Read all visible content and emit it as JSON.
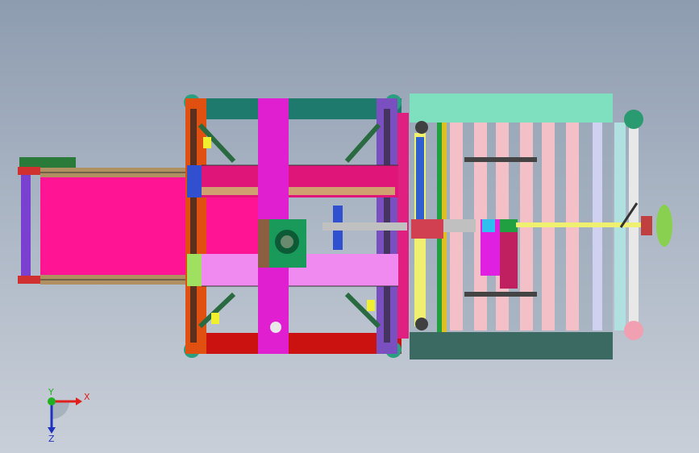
{
  "viewport": {
    "colors": {
      "background_top": "#8e9cb0",
      "background_bottom": "#c9cfd8"
    }
  },
  "triad": {
    "x_label": "X",
    "y_label": "Y",
    "z_label": "Z",
    "colors": {
      "x": "#e0201c",
      "y": "#20b020",
      "z": "#2030c0"
    }
  },
  "model": {
    "colors": {
      "infeed_belt": "#ff1493",
      "main_column": "#e020d0",
      "top_bar": "#1f7a6e",
      "bottom_bar": "#cc1111",
      "left_frame": "#e05010",
      "right_frame": "#7a50c0",
      "upper_carriage": "#e0157a",
      "lower_carriage": "#f08af0",
      "gearbox": "#1a9a5a",
      "roller_cover_top": "#7fe0c0",
      "roller_cover_bottom": "#3a6a62",
      "rollers": "#f4c0c8",
      "handwheel": "#8ad050",
      "shaft": "#f0f070"
    }
  }
}
